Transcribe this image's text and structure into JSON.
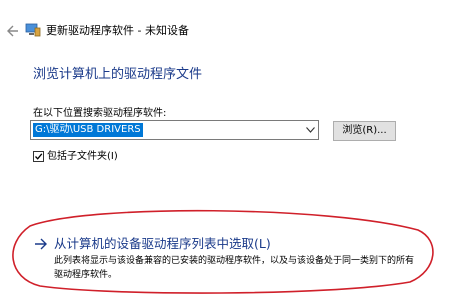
{
  "window": {
    "title": "更新驱动程序软件 - 未知设备"
  },
  "page": {
    "heading": "浏览计算机上的驱动程序文件",
    "search_label": "在以下位置搜索驱动程序软件:",
    "path_value": "G:\\驱动\\USB DRIVERS",
    "browse_label": "浏览(R)...",
    "include_subfolders_label": "包括子文件夹(I)",
    "include_subfolders_checked": true
  },
  "pick_option": {
    "title": "从计算机的设备驱动程序列表中选取(L)",
    "description": "此列表将显示与该设备兼容的已安装的驱动程序软件，以及与该设备处于同一类别下的所有驱动程序软件。"
  },
  "colors": {
    "accent": "#1a3a8a",
    "selection": "#0078d7",
    "annotation": "#d0202a"
  },
  "icons": {
    "back": "back-arrow-icon",
    "device": "device-manager-icon",
    "option": "right-arrow-icon"
  }
}
